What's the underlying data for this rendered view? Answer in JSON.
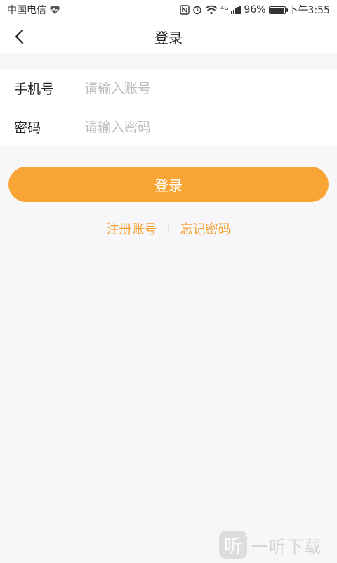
{
  "status_bar": {
    "carrier": "中国电信",
    "network": "4G",
    "battery": "96%",
    "battery_level": 0.96,
    "time": "下午3:55",
    "icons": [
      "heartbeat-icon",
      "nfc-icon",
      "alarm-icon",
      "wifi-icon",
      "signal-icon",
      "battery-icon"
    ]
  },
  "header": {
    "title": "登录",
    "back_icon": "chevron-left-icon"
  },
  "form": {
    "phone": {
      "label": "手机号",
      "placeholder": "请输入账号",
      "value": ""
    },
    "password": {
      "label": "密码",
      "placeholder": "请输入密码",
      "value": ""
    }
  },
  "login_button": {
    "label": "登录"
  },
  "links": {
    "register": "注册账号",
    "forgot": "忘记密码"
  },
  "watermark": {
    "logo_char": "听",
    "text": "一听下载"
  },
  "colors": {
    "accent": "#f8a536",
    "link": "#f5a030",
    "background": "#f7f7f9"
  }
}
